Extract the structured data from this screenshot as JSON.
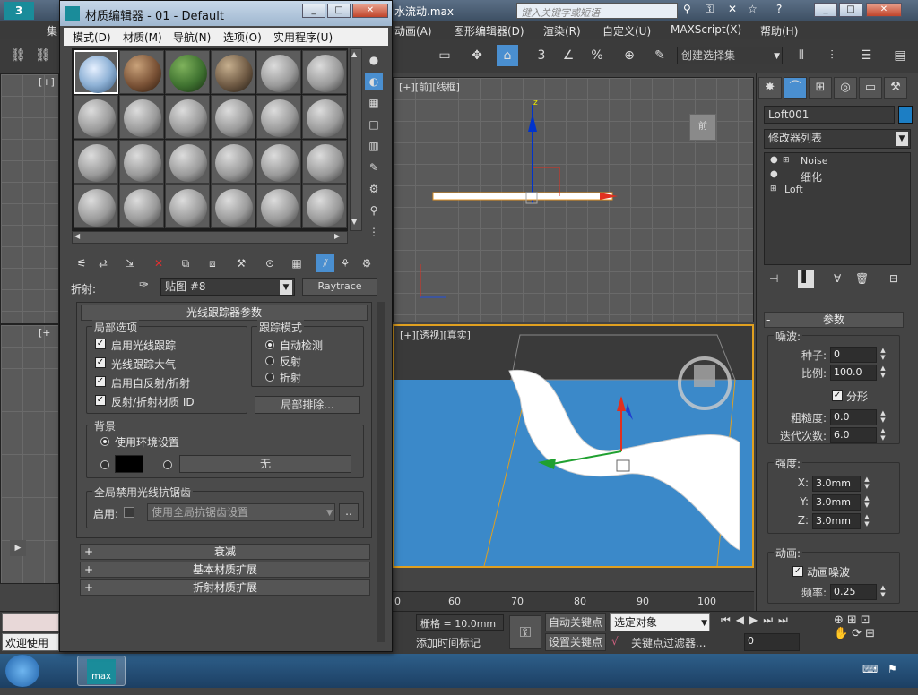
{
  "main": {
    "title_fragment": "水流动.max",
    "search_placeholder": "键入关键字或短语",
    "menus": [
      "动画(A)",
      "图形编辑器(D)",
      "渲染(R)",
      "自定义(U)",
      "MAXScript(X)",
      "帮助(H)"
    ],
    "selection_set_placeholder": "创建选择集",
    "menu_cut": "集",
    "left_vp_label": "[+]",
    "left_vp_label2": "[+",
    "front_vp_label": "[+][前][线框]",
    "persp_vp_label": "[+][透视][真实]",
    "viewcube_front": "前"
  },
  "command_panel": {
    "object_name": "Loft001",
    "modifier_list": "修改器列表",
    "stack": [
      "Noise",
      "细化",
      "Loft"
    ],
    "params_title": "参数",
    "noise_group": "噪波:",
    "seed_label": "种子:",
    "seed_value": "0",
    "scale_label": "比例:",
    "scale_value": "100.0",
    "fractal_label": "分形",
    "roughness_label": "粗糙度:",
    "roughness_value": "0.0",
    "iterations_label": "迭代次数:",
    "iterations_value": "6.0",
    "strength_group": "强度:",
    "x_label": "X:",
    "x_value": "3.0mm",
    "y_label": "Y:",
    "y_value": "3.0mm",
    "z_label": "Z:",
    "z_value": "3.0mm",
    "anim_group": "动画:",
    "anim_noise_label": "动画噪波",
    "freq_label": "频率:",
    "freq_value": "0.25"
  },
  "bottom": {
    "grid_label": "栅格 = 10.0mm",
    "add_time_tag": "添加时间标记",
    "auto_key": "自动关键点",
    "set_key": "设置关键点",
    "key_mode": "选定对象",
    "key_filters": "关键点过滤器...",
    "frame_value": "0",
    "status_left": "欢迎使用",
    "ruler": [
      "0",
      "60",
      "70",
      "80",
      "90",
      "100"
    ]
  },
  "mated": {
    "title": "材质编辑器 - 01 - Default",
    "menu": [
      "模式(D)",
      "材质(M)",
      "导航(N)",
      "选项(O)",
      "实用程序(U)"
    ],
    "refraction_label": "折射:",
    "map_name": "贴图 #8",
    "map_type": "Raytrace",
    "raytracer_title": "光线跟踪器参数",
    "local_options": "局部选项",
    "opt1": "启用光线跟踪",
    "opt2": "光线跟踪大气",
    "opt3": "启用自反射/折射",
    "opt4": "反射/折射材质 ID",
    "trace_mode": "跟踪模式",
    "trace_auto": "自动检测",
    "trace_reflect": "反射",
    "trace_refract": "折射",
    "local_exclude": "局部排除...",
    "background": "背景",
    "use_env": "使用环境设置",
    "none": "无",
    "global_aa": "全局禁用光线抗锯齿",
    "enable": "启用:",
    "aa_setting": "使用全局抗锯齿设置",
    "ellipsis": "..",
    "rollouts": [
      "衰减",
      "基本材质扩展",
      "折射材质扩展"
    ]
  },
  "taskbar": {
    "app_label": "max"
  }
}
